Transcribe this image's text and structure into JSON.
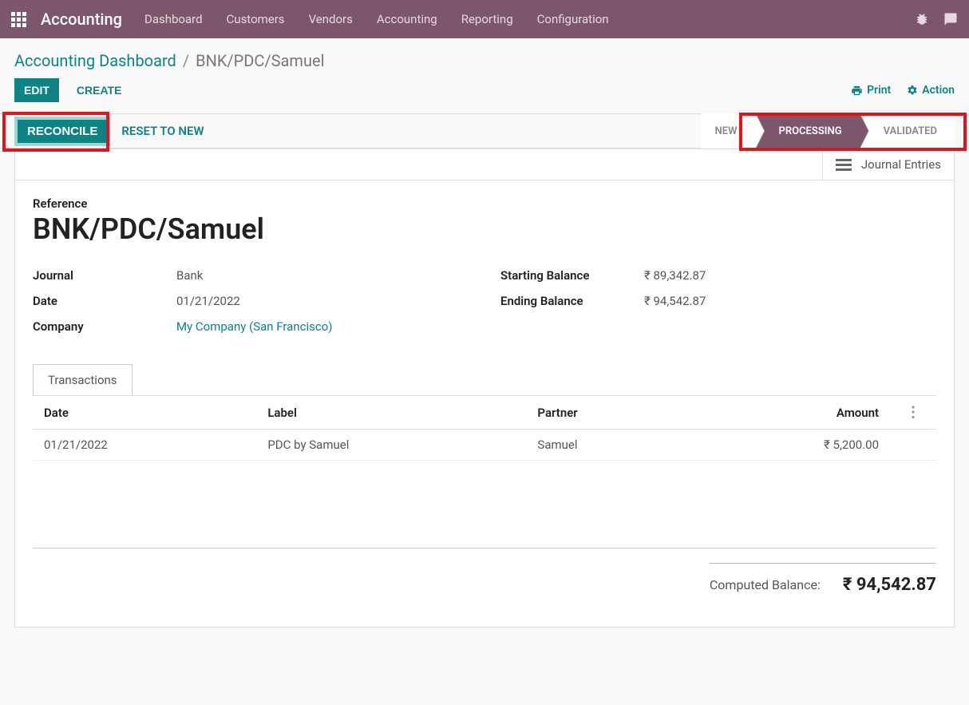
{
  "topbar": {
    "brand": "Accounting",
    "menu": [
      "Dashboard",
      "Customers",
      "Vendors",
      "Accounting",
      "Reporting",
      "Configuration"
    ]
  },
  "breadcrumb": {
    "root": "Accounting Dashboard",
    "current": "BNK/PDC/Samuel"
  },
  "toolbar": {
    "edit": "EDIT",
    "create": "CREATE",
    "print": "Print",
    "action": "Action"
  },
  "secondary": {
    "reconcile": "RECONCILE",
    "reset": "RESET TO NEW"
  },
  "status": {
    "new": "NEW",
    "processing": "PROCESSING",
    "validated": "VALIDATED",
    "active": "processing"
  },
  "stat_button": {
    "label": "Journal Entries"
  },
  "record": {
    "reference_label": "Reference",
    "reference_value": "BNK/PDC/Samuel",
    "journal_label": "Journal",
    "journal_value": "Bank",
    "date_label": "Date",
    "date_value": "01/21/2022",
    "company_label": "Company",
    "company_value": "My Company (San Francisco)",
    "starting_balance_label": "Starting Balance",
    "starting_balance_value": "₹ 89,342.87",
    "ending_balance_label": "Ending Balance",
    "ending_balance_value": "₹ 94,542.87"
  },
  "tabs": {
    "transactions": "Transactions"
  },
  "transactions_headers": {
    "date": "Date",
    "label": "Label",
    "partner": "Partner",
    "amount": "Amount"
  },
  "transactions": [
    {
      "date": "01/21/2022",
      "label": "PDC by Samuel",
      "partner": "Samuel",
      "amount": "₹ 5,200.00"
    }
  ],
  "footer": {
    "computed_balance_label": "Computed Balance:",
    "computed_balance_value": "₹ 94,542.87"
  }
}
